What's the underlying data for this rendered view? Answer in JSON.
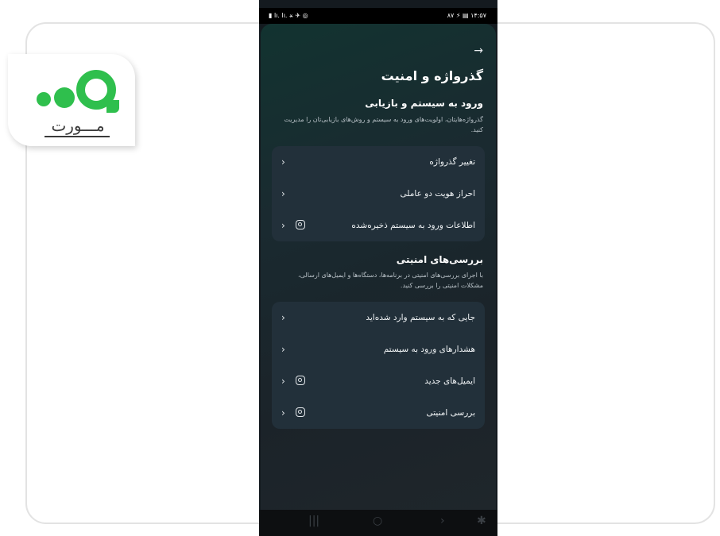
{
  "watermark": {
    "logo_text": "مـــورت"
  },
  "statusbar": {
    "left_icons": "▮ lı. lı. ⚹ ✈ ◎",
    "right_status": "۸۷ ⚡ ▤ ۱۴:۵۷"
  },
  "header": {
    "back_icon": "→",
    "title": "گذرواژه و امنیت"
  },
  "login_section": {
    "title": "ورود به سیستم و بازیابی",
    "description": "گذرواژه‌هایتان، اولویت‌های ورود به سیستم و روش‌های بازیابی‌تان را مدیریت کنید.",
    "items": [
      {
        "label": "تغییر گذرواژه",
        "chevron": "‹",
        "insta": false
      },
      {
        "label": "احراز هویت دو عاملی",
        "chevron": "‹",
        "insta": false
      },
      {
        "label": "اطلاعات ورود به سیستم ذخیره‌شده",
        "chevron": "‹",
        "insta": true
      }
    ]
  },
  "security_section": {
    "title": "بررسی‌های امنیتی",
    "description": "با اجرای بررسی‌های امنیتی در برنامه‌ها، دستگاه‌ها و ایمیل‌های ارسالی، مشکلات امنیتی را بررسی کنید.",
    "items": [
      {
        "label": "جایی که به سیستم وارد شده‌اید",
        "chevron": "‹",
        "insta": false
      },
      {
        "label": "هشدارهای ورود به سیستم",
        "chevron": "‹",
        "insta": false
      },
      {
        "label": "ایمیل‌های جدید",
        "chevron": "‹",
        "insta": true
      },
      {
        "label": "بررسی امنیتی",
        "chevron": "‹",
        "insta": true
      }
    ]
  },
  "navbar": {
    "recent_icon": "|||",
    "home_icon": "○",
    "back_icon": "›",
    "accessibility_icon": "✱"
  }
}
